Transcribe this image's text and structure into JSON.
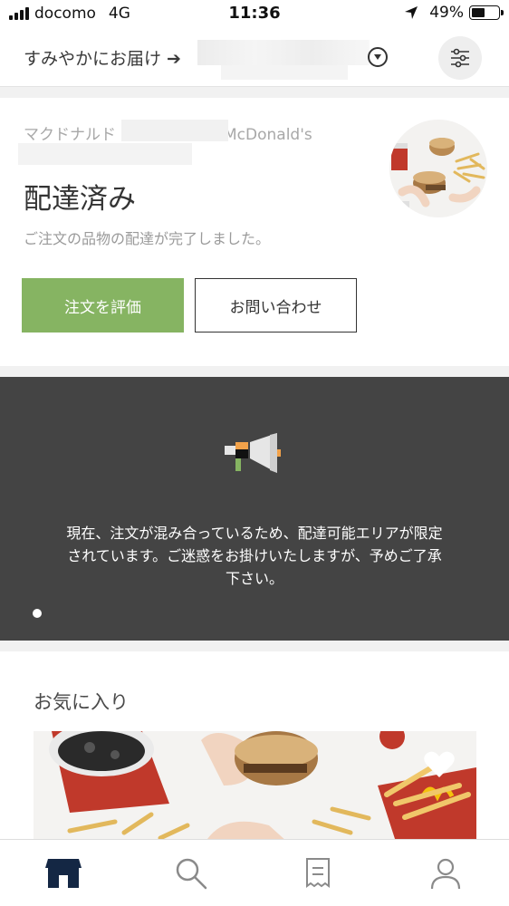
{
  "status_bar": {
    "carrier": "docomo",
    "network": "4G",
    "time": "11:36",
    "battery": "49%",
    "battery_level": 0.49
  },
  "header": {
    "deliver_label": "すみやかにお届け ➔"
  },
  "order": {
    "store_name": "マクドナルド　　　　　　　McDonald's",
    "status_title": "配達済み",
    "status_desc": "ご注文の品物の配達が完了しました。",
    "rate_button": "注文を評価",
    "contact_button": "お問い合わせ"
  },
  "announcement": {
    "message": "現在、注文が混み合っているため、配達可能エリアが限定されています。ご迷惑をお掛けいたしますが、予めご了承下さい。",
    "page_count": 1,
    "current_page": 1
  },
  "favorites": {
    "title": "お気に入り"
  },
  "bottom_nav": {
    "items": [
      {
        "icon": "home-icon",
        "active": true
      },
      {
        "icon": "search-icon",
        "active": false
      },
      {
        "icon": "receipt-icon",
        "active": false
      },
      {
        "icon": "account-icon",
        "active": false
      }
    ]
  },
  "colors": {
    "accent_green": "#86b462",
    "banner_dark": "#444444",
    "megaphone_orange": "#f2a24a",
    "megaphone_green": "#86b462"
  }
}
